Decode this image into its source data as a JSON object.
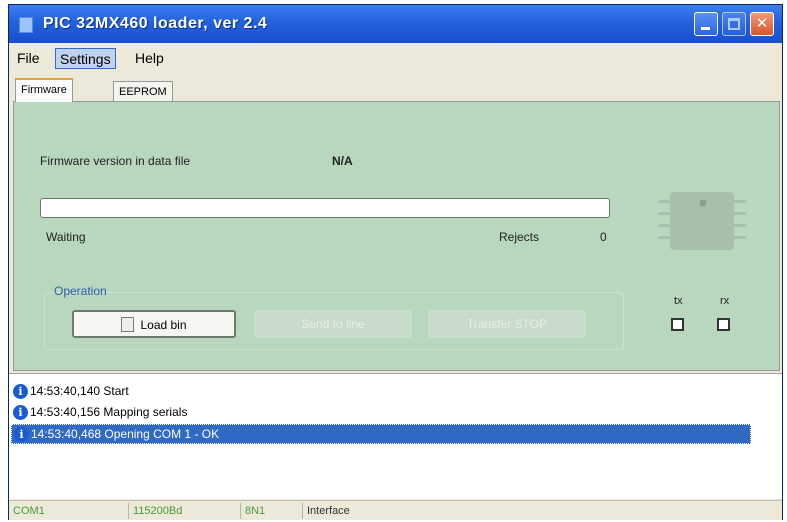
{
  "window": {
    "title": "PIC 32MX460 loader, ver 2.4",
    "title_bar_color": "#2461dc"
  },
  "menu": {
    "items": [
      "File",
      "Settings",
      "Help"
    ],
    "active": "Settings"
  },
  "tabs": [
    "Firmware",
    "EEPROM"
  ],
  "firmware": {
    "version_label": "Firmware version in data file",
    "version_value": "N/A",
    "progress_percent": 0,
    "status": "Waiting",
    "rejects_label": "Rejects",
    "rejects_value": "0",
    "operation_label": "Operation",
    "buttons": {
      "load": "Load bin",
      "send": "Send to line",
      "stop": "Transfer STOP"
    },
    "tx_label": "tx",
    "rx_label": "rx",
    "panel_color": "#b9d7bd"
  },
  "log": [
    {
      "text": "14:53:40,140 Start",
      "icon": "info-icon",
      "selected": false
    },
    {
      "text": "14:53:40,156 Mapping serials",
      "icon": "info-icon",
      "selected": false
    },
    {
      "text": "14:53:40,468 Opening COM 1 - OK",
      "icon": "info-icon",
      "selected": true
    }
  ],
  "statusbar": {
    "port": "COM1",
    "baud": "115200Bd",
    "format": "8N1",
    "interface": "Interface"
  }
}
